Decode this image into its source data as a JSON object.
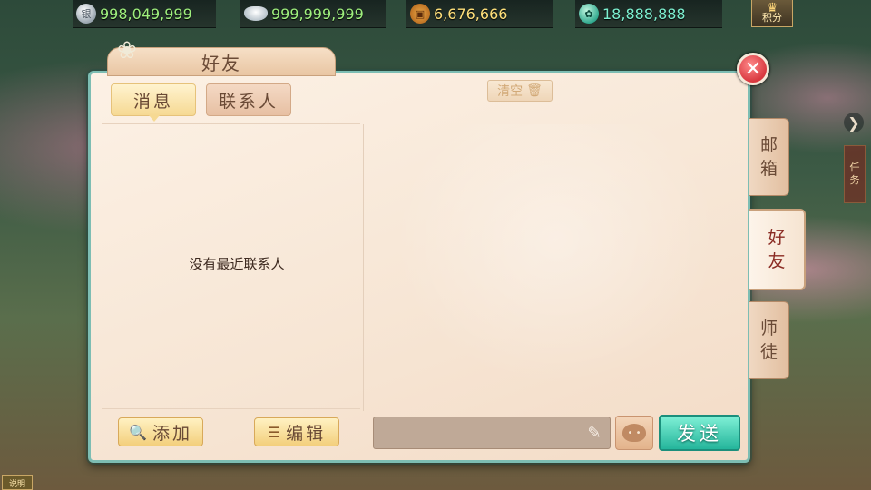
{
  "currencies": [
    {
      "icon": "silver-coin-icon",
      "glyph": "银",
      "value": "998,049,999"
    },
    {
      "icon": "silver-ingot-icon",
      "glyph": "",
      "value": "999,999,999"
    },
    {
      "icon": "copper-coin-icon",
      "glyph": "▣",
      "value": "6,676,666"
    },
    {
      "icon": "jade-icon",
      "glyph": "✿",
      "value": "18,888,888"
    }
  ],
  "score_button": {
    "label": "积分"
  },
  "panel": {
    "title": "好友",
    "close_glyph": "✕"
  },
  "tabs": {
    "messages": "消息",
    "contacts": "联系人"
  },
  "clear_button": {
    "label": "清空",
    "icon_glyph": "🗑"
  },
  "empty_text": "没有最近联系人",
  "left_buttons": {
    "add": "添加",
    "add_icon": "🔍",
    "edit": "编辑",
    "edit_icon": "☰"
  },
  "chat": {
    "input_value": "",
    "pen_glyph": "✎",
    "emoji_glyph": "• •",
    "send": "发送"
  },
  "side_tabs": [
    {
      "line1": "邮",
      "line2": "箱"
    },
    {
      "line1": "好",
      "line2": "友"
    },
    {
      "line1": "师",
      "line2": "徒"
    }
  ],
  "hud": {
    "arrow_glyph": "❯",
    "task_line1": "任",
    "task_line2": "务",
    "bottom_badge": "说明"
  },
  "colors": {
    "panel_border": "#7dbdb3",
    "send_button": "#24b59b",
    "currency_green": "#9ff07d",
    "currency_gold": "#ffe07a",
    "currency_jade": "#7cf0d0"
  }
}
